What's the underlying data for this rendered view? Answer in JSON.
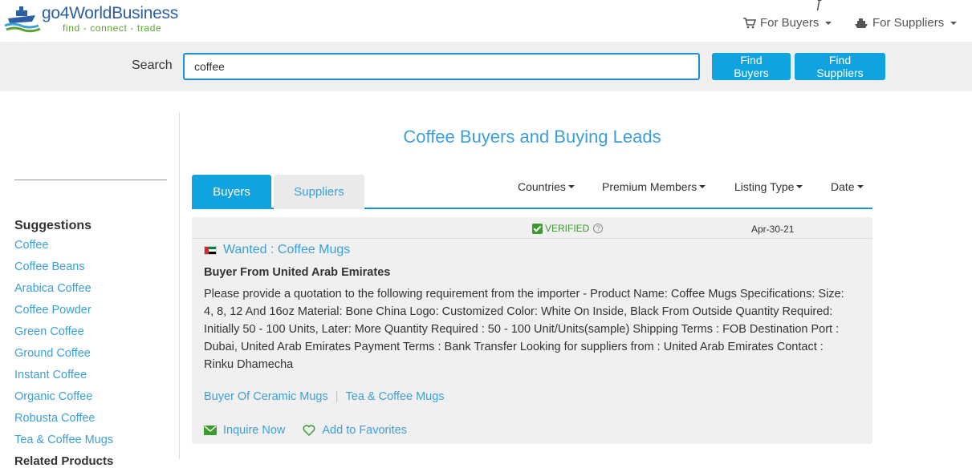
{
  "header": {
    "logo_name": "go4WorldBusiness",
    "logo_tagline": "find - connect - trade",
    "nav_buyers": "For Buyers",
    "nav_suppliers": "For Suppliers"
  },
  "search": {
    "label": "Search",
    "value": "coffee",
    "find_buyers": "Find Buyers",
    "find_suppliers": "Find Suppliers"
  },
  "sidebar": {
    "heading": "Suggestions",
    "items": [
      "Coffee",
      "Coffee Beans",
      "Arabica Coffee",
      "Coffee Powder",
      "Green Coffee",
      "Ground Coffee",
      "Instant Coffee",
      "Organic Coffee",
      "Robusta Coffee",
      "Tea & Coffee Mugs"
    ],
    "cutoff_heading": "Related Products"
  },
  "main": {
    "title": "Coffee Buyers and Buying Leads",
    "tabs": [
      "Buyers",
      "Suppliers"
    ],
    "filters": [
      "Countries",
      "Premium Members",
      "Listing Type",
      "Date"
    ]
  },
  "listing": {
    "verified": "VERIFIED",
    "date": "Apr-30-21",
    "title": "Wanted : Coffee Mugs",
    "buyer_from": "Buyer From United Arab Emirates",
    "description": "Please provide a quotation to the following requirement from the importer - Product Name: Coffee Mugs Specifications: Size: 4, 8, 12 And 16oz Material: Bone China Logo: Customized Color: White On Inside, Black From Outside Quantity Required: Initially 50 - 100 Units, Later: More Quantity Required : 50 - 100 Unit/Units(sample) Shipping Terms : FOB Destination Port : Dubai, United Arab Emirates Payment Terms : Bank Transfer Looking for suppliers from : United Arab Emirates Contact : Rinku Dhamecha",
    "tags": [
      "Buyer Of Ceramic Mugs",
      "Tea & Coffee Mugs"
    ],
    "inquire": "Inquire Now",
    "favorite": "Add to Favorites"
  },
  "colors": {
    "accent": "#10a3e0",
    "link": "#3ba0d9",
    "verified": "#3a9a2c"
  }
}
